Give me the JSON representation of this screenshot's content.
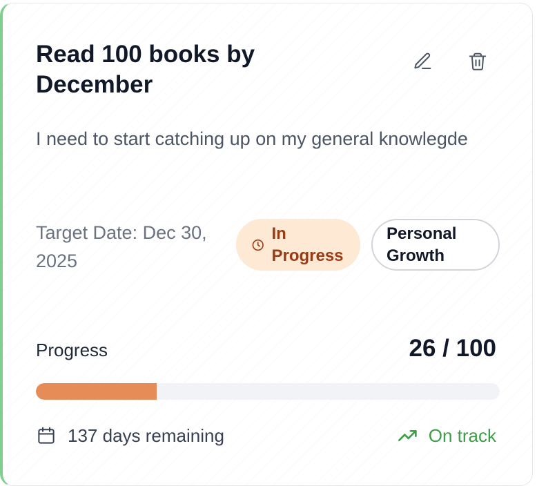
{
  "goal": {
    "title": "Read 100 books by December",
    "description": "I need to start catching up on my general knowlegde",
    "target_date": "Target Date: Dec 30, 2025",
    "status": "In Progress",
    "category": "Personal Growth",
    "accent_color": "#7fd08f"
  },
  "progress": {
    "label": "Progress",
    "count_text": "26 / 100",
    "current": 26,
    "total": 100,
    "fill_color": "#e58c57"
  },
  "footer": {
    "days_remaining": "137 days remaining",
    "track_status": "On track",
    "track_color": "#3f9e4a"
  },
  "icons": {
    "edit": "pencil-icon",
    "delete": "trash-icon",
    "status": "clock-icon",
    "calendar": "calendar-icon",
    "trend": "trending-up-icon"
  }
}
